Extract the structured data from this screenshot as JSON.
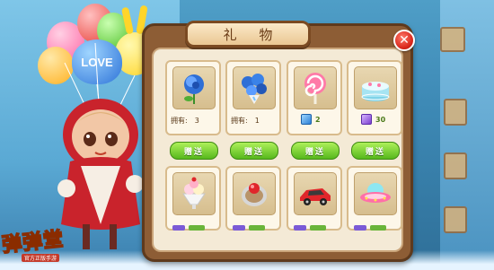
{
  "dialog": {
    "title": "礼 物",
    "close_label": "✕"
  },
  "items_row1": [
    {
      "name": "blue-rose",
      "owned_label": "拥有:",
      "owned_count": "3",
      "button": "赠送"
    },
    {
      "name": "blue-bouquet",
      "owned_label": "拥有:",
      "owned_count": "1",
      "button": "赠送"
    },
    {
      "name": "lollipop",
      "price": "2",
      "currency": "diamond-blue",
      "button": "赠送"
    },
    {
      "name": "cake",
      "price": "30",
      "currency": "diamond-purple",
      "button": "赠送"
    }
  ],
  "items_row2": [
    {
      "name": "ice-cream-sundae"
    },
    {
      "name": "ring"
    },
    {
      "name": "sports-car"
    },
    {
      "name": "ufo"
    }
  ],
  "balloon_text": "LOVE",
  "logo": {
    "text": "弹弹堂",
    "sub": "官方正版手游"
  },
  "colors": {
    "frame": "#8d5d35",
    "panel": "#f4ead6",
    "button_green": "#57b81c",
    "close_red": "#d9261b"
  }
}
